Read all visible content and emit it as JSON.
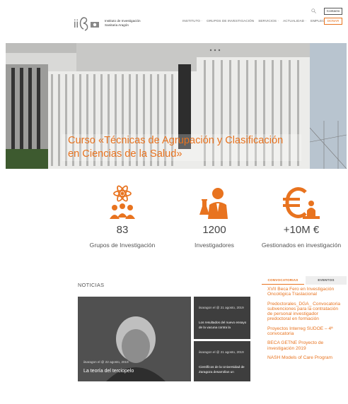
{
  "header": {
    "logo_text_line1": "Instituto de Investigación",
    "logo_text_line2": "Sanitaria Aragón",
    "nav": [
      "INSTITUTO ·",
      "GRUPOS DE INVESTIGACIÓN",
      "SERVICIOS ·",
      "ACTUALIDAD ·",
      "EMPLEO"
    ],
    "contact_label": "Contacto",
    "donate_label": "DONAR"
  },
  "hero": {
    "title_line1": "Curso «Técnicas de Agrupación y Clasificación",
    "title_line2": "en Ciencias de la Salud»"
  },
  "stats": [
    {
      "value": "83",
      "label": "Grupos de Investigación",
      "icon": "atom-people-icon"
    },
    {
      "value": "1200",
      "label": "Investigadores",
      "icon": "researcher-icon"
    },
    {
      "value": "+10M €",
      "label": "Gestionados en investigación",
      "icon": "euro-icon"
    }
  ],
  "news": {
    "heading": "NOTICIAS",
    "featured": {
      "meta": "iisaragon el @ 22 agosto, 2019",
      "title": "La teoría del terciopelo"
    },
    "items": [
      {
        "meta": "iisaragon el @ 21 agosto, 2019",
        "snippet": "Los resultados del nuevo ensayo de la vacuna contra la"
      },
      {
        "meta": "iisaragon el @ 21 agosto, 2019",
        "snippet": "Científicos de la Universidad de Zaragoza desarrollan un"
      }
    ]
  },
  "tabs": {
    "active": "CONVOCATORIAS",
    "inactive": "EVENTOS"
  },
  "convocatorias": [
    "XVII Beca Fero en Investigación Oncológica Traslacional",
    "Predoctorales_DGA_ Convocatoria subvenciones para la contratación de personal investigador predoctoral en formación",
    "Proyectos Interreg SUDOE – 4ª convocatoria",
    "BECA GETNE Proyecto de investigación 2019",
    "NASH Models of Care Program"
  ],
  "colors": {
    "accent": "#e8731f"
  }
}
